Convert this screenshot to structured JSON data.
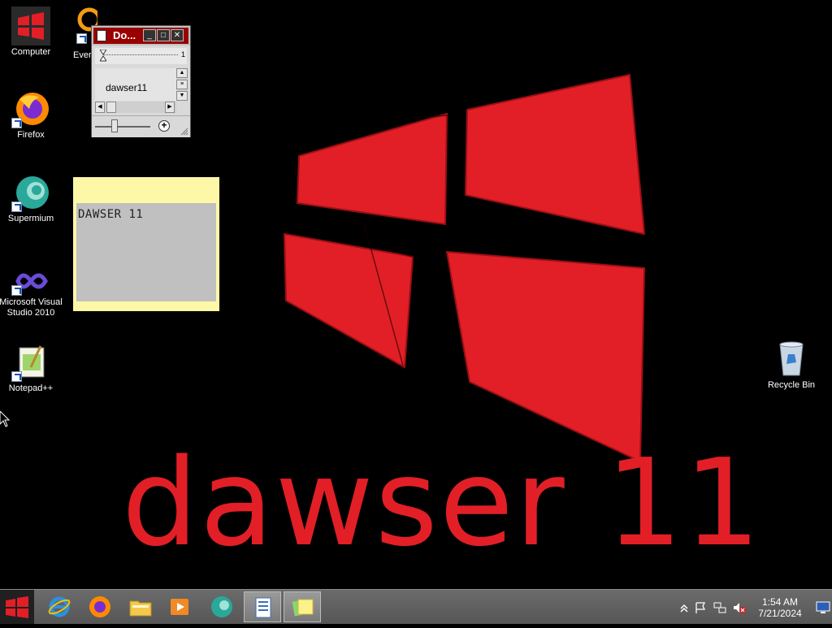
{
  "wallpaper": {
    "brand_text": "dawser 11",
    "accent_color": "#e21f26"
  },
  "desktop_icons": [
    {
      "name": "computer",
      "label": "Computer",
      "icon": "windows-logo-icon"
    },
    {
      "name": "evernote",
      "label": "Ever",
      "icon": "evernote-icon"
    },
    {
      "name": "firefox",
      "label": "Firefox",
      "icon": "firefox-icon"
    },
    {
      "name": "supermium",
      "label": "Supermium",
      "icon": "supermium-icon"
    },
    {
      "name": "visual-studio",
      "label": "Microsoft Visual Studio 2010",
      "icon": "visual-studio-icon"
    },
    {
      "name": "notepadpp",
      "label": "Notepad++",
      "icon": "notepadpp-icon"
    },
    {
      "name": "recycle-bin",
      "label": "Recycle Bin",
      "icon": "recycle-bin-icon"
    }
  ],
  "doc_window": {
    "title": "Do...",
    "ruler_number": "1",
    "content": "dawser11",
    "title_color": "#990000"
  },
  "sticky_note": {
    "text": "DAWSER 11",
    "color": "#fdf7a8"
  },
  "taskbar": {
    "start_icon": "windows-logo-icon",
    "items": [
      {
        "name": "internet-explorer",
        "icon": "internet-explorer-icon",
        "active": false
      },
      {
        "name": "firefox",
        "icon": "firefox-icon",
        "active": false
      },
      {
        "name": "file-explorer",
        "icon": "folder-icon",
        "active": false
      },
      {
        "name": "media-player",
        "icon": "media-player-icon",
        "active": false
      },
      {
        "name": "supermium",
        "icon": "supermium-icon",
        "active": false
      },
      {
        "name": "wordpad",
        "icon": "wordpad-icon",
        "active": true
      },
      {
        "name": "sticky-notes",
        "icon": "sticky-notes-icon",
        "active": true
      }
    ],
    "tray": {
      "time": "1:54 AM",
      "date": "7/21/2024",
      "icons": [
        "chevron-up-icon",
        "flag-icon",
        "network-icon",
        "volume-muted-icon",
        "show-desktop-icon"
      ]
    }
  }
}
